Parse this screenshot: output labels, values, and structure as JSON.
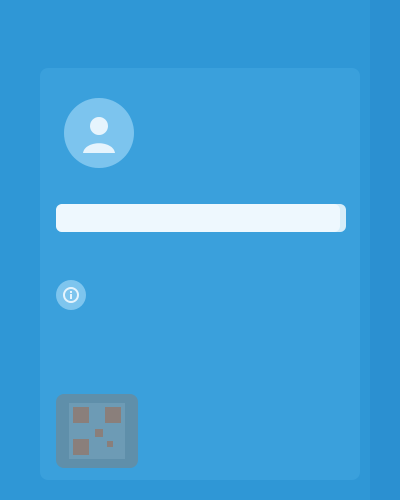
{
  "topbar": {
    "left_label": "",
    "right_label": ""
  },
  "profile": {
    "lines": [
      "",
      "",
      ""
    ],
    "avatar_icon": "user-icon"
  },
  "progress": {
    "fraction": 0.98
  },
  "rows": [
    {
      "icon": "info-icon",
      "label": "",
      "value": ""
    },
    {
      "icon": "",
      "label": "",
      "value": ""
    }
  ],
  "code": {
    "icon": "qr-code-icon",
    "text": ""
  },
  "colors": {
    "background": "#2f97d6",
    "card": "#3aa0dc",
    "accent_light": "#d6edf9"
  }
}
